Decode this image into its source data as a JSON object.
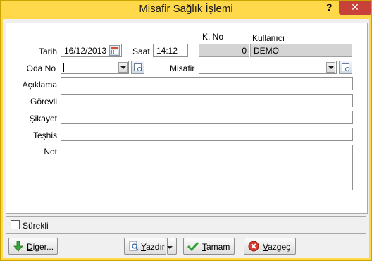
{
  "window": {
    "title": "Misafir Sağlık İşlemi",
    "help": "?",
    "close": "✕"
  },
  "form": {
    "tarih_label": "Tarih",
    "tarih_value": "16/12/2013",
    "saat_label": "Saat",
    "saat_value": "14:12",
    "kno_label": "K. No",
    "kno_value": "0",
    "kullanici_label": "Kullanıcı",
    "kullanici_value": "DEMO",
    "odano_label": "Oda No",
    "odano_value": "",
    "misafir_label": "Misafir",
    "misafir_value": "",
    "aciklama_label": "Açıklama",
    "gorevli_label": "Görevli",
    "sikayet_label": "Şikayet",
    "teshis_label": "Teşhis",
    "not_label": "Not"
  },
  "options": {
    "surekli_label": "Sürekli",
    "surekli_checked": false
  },
  "buttons": {
    "diger_first": "D",
    "diger_rest": "iger...",
    "yazdir_first": "Y",
    "yazdir_rest": "azdır",
    "tamam_first": "T",
    "tamam_rest": "amam",
    "vazgec_first": "V",
    "vazgec_rest": "azgeç"
  },
  "colors": {
    "frame": "#ffd94a",
    "close": "#c8423a",
    "readonly": "#d4d4d4"
  }
}
